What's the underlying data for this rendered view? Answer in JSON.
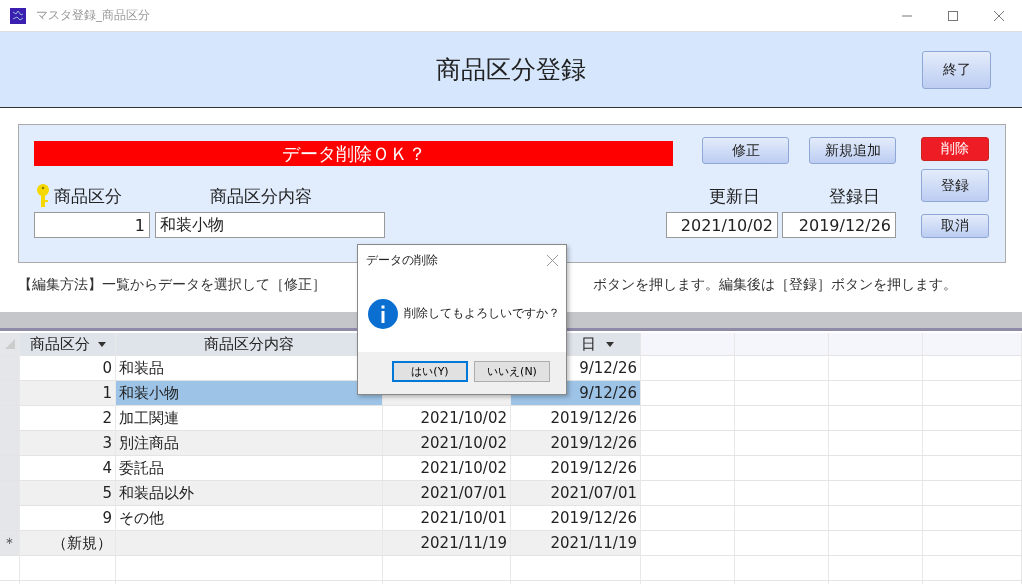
{
  "window": {
    "title": "マスタ登録_商品区分"
  },
  "header": {
    "title": "商品区分登録",
    "exit_button": "終了"
  },
  "form": {
    "message": "データ削除ＯＫ？",
    "top_buttons": [
      {
        "label": "修正"
      },
      {
        "label": "新規追加"
      }
    ],
    "side_buttons": [
      {
        "label": "削除",
        "kind": "danger"
      },
      {
        "label": "登録",
        "kind": "tall"
      },
      {
        "label": "取消",
        "kind": "normal"
      }
    ],
    "fields": [
      {
        "label": "商品区分",
        "value": "1",
        "kind": "number",
        "key": true
      },
      {
        "label": "商品区分内容",
        "value": "和装小物",
        "kind": "text",
        "key": false
      },
      {
        "label": "更新日",
        "value": "2021/10/02",
        "kind": "date",
        "key": false
      },
      {
        "label": "登録日",
        "value": "2019/12/26",
        "kind": "date",
        "key": false
      }
    ]
  },
  "instructions": [
    "【編集方法】一覧からデータを選択して［修正］",
    "ボタンを押します。編集後は［登録］ボタンを押します。"
  ],
  "table": {
    "columns": [
      {
        "label": "商品区分",
        "dropdown": true
      },
      {
        "label": "商品区分内容",
        "dropdown": false
      },
      {},
      {
        "label": "日",
        "dropdown": true
      }
    ],
    "rows": [
      {
        "kind": "record",
        "code": "0",
        "name": "和装品",
        "registered": "9/12/26",
        "selected": false
      },
      {
        "kind": "record",
        "code": "1",
        "name": "和装小物",
        "registered": "9/12/26",
        "selected": true
      },
      {
        "kind": "record",
        "code": "2",
        "name": "加工関連",
        "updated": "2021/10/02",
        "registered": "2019/12/26",
        "selected": false
      },
      {
        "kind": "record",
        "code": "3",
        "name": "別注商品",
        "updated": "2021/10/02",
        "registered": "2019/12/26",
        "selected": false
      },
      {
        "kind": "record",
        "code": "4",
        "name": "委託品",
        "updated": "2021/10/02",
        "registered": "2019/12/26",
        "selected": false
      },
      {
        "kind": "record",
        "code": "5",
        "name": "和装品以外",
        "updated": "2021/07/01",
        "registered": "2021/07/01",
        "selected": false
      },
      {
        "kind": "record",
        "code": "9",
        "name": "その他",
        "updated": "2021/10/01",
        "registered": "2019/12/26",
        "selected": false
      },
      {
        "kind": "new",
        "marker": "＊",
        "code": "（新規）",
        "updated": "2021/11/19",
        "registered": "2021/11/19",
        "selected": false
      }
    ]
  },
  "dialog": {
    "title": "データの削除",
    "message": "削除してもよろしいですか？",
    "buttons": [
      {
        "label": "はい(Y)",
        "selected": true
      },
      {
        "label": "いいえ(N)",
        "selected": false
      }
    ]
  }
}
